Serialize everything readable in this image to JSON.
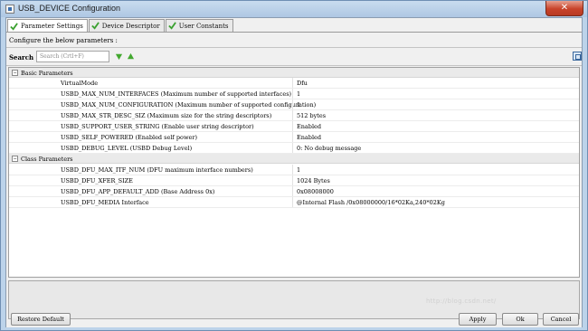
{
  "window": {
    "title": "USB_DEVICE Configuration",
    "close_glyph": "✕"
  },
  "tabs": [
    {
      "label": "Parameter Settings",
      "active": true
    },
    {
      "label": "Device Descriptor",
      "active": false
    },
    {
      "label": "User Constants",
      "active": false
    }
  ],
  "configure_text": "Configure the below parameters :",
  "search": {
    "label": "Search",
    "placeholder": "Search (Crtl+F)"
  },
  "groups": [
    {
      "label": "Basic Parameters",
      "expander": "−",
      "rows": [
        {
          "name": "VirtualMode",
          "value": "Dfu"
        },
        {
          "name": "USBD_MAX_NUM_INTERFACES (Maximum number of supported interfaces)",
          "value": "1"
        },
        {
          "name": "USBD_MAX_NUM_CONFIGURATION (Maximum number of supported configuration)",
          "value": "1"
        },
        {
          "name": "USBD_MAX_STR_DESC_SIZ (Maximum size for the string descriptors)",
          "value": "512 bytes"
        },
        {
          "name": "USBD_SUPPORT_USER_STRING (Enable user string descriptor)",
          "value": "Enabled"
        },
        {
          "name": "USBD_SELF_POWERED (Enabled self power)",
          "value": "Enabled"
        },
        {
          "name": "USBD_DEBUG_LEVEL (USBD Debug Level)",
          "value": "0: No debug message"
        }
      ]
    },
    {
      "label": "Class Parameters",
      "expander": "−",
      "rows": [
        {
          "name": "USBD_DFU_MAX_ITF_NUM (DFU maximum interface numbers)",
          "value": "1"
        },
        {
          "name": "USBD_DFU_XFER_SIZE",
          "value": "1024 Bytes"
        },
        {
          "name": "USBD_DFU_APP_DEFAULT_ADD (Base Address 0x)",
          "value": "0x08008000"
        },
        {
          "name": "USBD_DFU_MEDIA Interface",
          "value": "@Internal Flash   /0x08000000/16*02Ka,240*02Kg"
        }
      ]
    }
  ],
  "buttons": {
    "restore": "Restore Default",
    "apply": "Apply",
    "ok": "Ok",
    "cancel": "Cancel"
  },
  "watermark": "http://blog.csdn.net/",
  "colors": {
    "accent": "#39679d",
    "check_green": "#3aa12f",
    "arrow_green": "#43a82f"
  }
}
